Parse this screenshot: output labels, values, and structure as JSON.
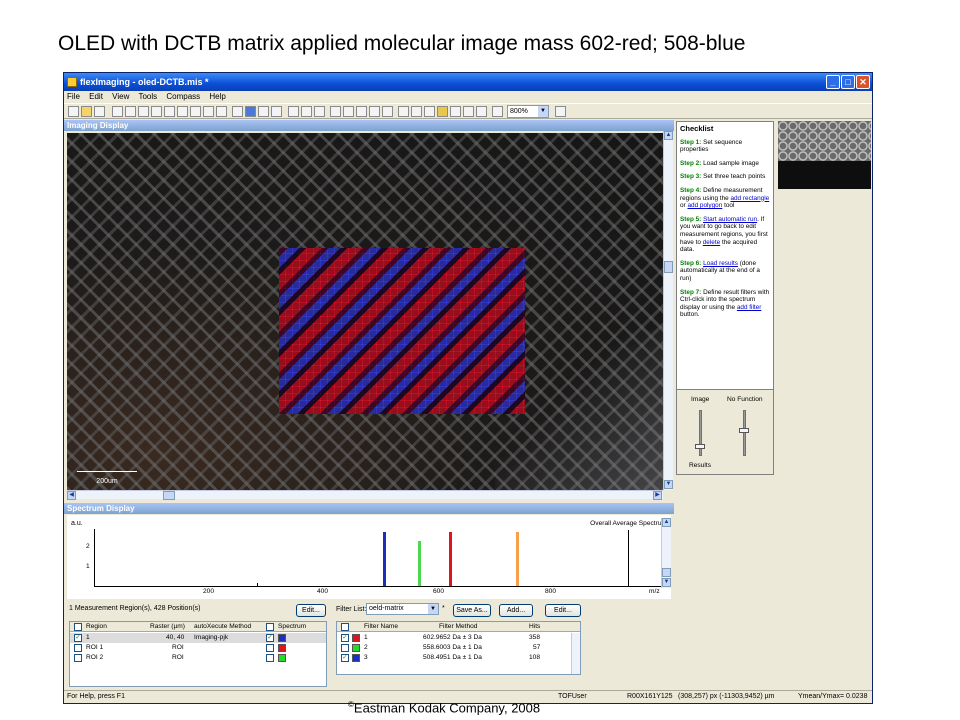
{
  "slide": {
    "title": "OLED with DCTB matrix applied  molecular image mass 602-red; 508-blue",
    "copyright_symbol": "©",
    "copyright_text": "Eastman Kodak Company, 2008"
  },
  "window": {
    "title": "flexImaging - oled-DCTB.mis *",
    "min_glyph": "_",
    "max_glyph": "□",
    "close_glyph": "✕"
  },
  "menu": [
    "File",
    "Edit",
    "View",
    "Tools",
    "Compass",
    "Help"
  ],
  "toolbar": {
    "zoom": "800%"
  },
  "imaging": {
    "header": "Imaging Display",
    "scale_label": "200um"
  },
  "checklist": {
    "title": "Checklist",
    "steps": [
      {
        "label": "Step 1:",
        "text": "Set sequence properties"
      },
      {
        "label": "Step 2:",
        "text": "Load sample image"
      },
      {
        "label": "Step 3:",
        "text": "Set three teach points"
      },
      {
        "label": "Step 4:",
        "pre": "Define measurement regions using the ",
        "link1": "add rectangle",
        "mid": " or ",
        "link2": "add polygon",
        "post": " tool"
      },
      {
        "label": "Step 5:",
        "link1": "Start automatic run",
        "post": ". If you want to go back to edit measurement regions, you first have to ",
        "link2": "delete",
        "post2": " the acquired data."
      },
      {
        "label": "Step 6:",
        "link1": "Load results",
        "post": " (done automatically at the end of a run)"
      },
      {
        "label": "Step 7:",
        "pre": "Define result filters with Ctrl-click into the spectrum display or using the ",
        "link1": "add filter",
        "post": " button."
      }
    ]
  },
  "sliders": {
    "left_label": "Image",
    "right_label": "No Function",
    "bottom_label": "Results"
  },
  "spectrum": {
    "header": "Spectrum Display",
    "yunit": "a.u.",
    "title": "Overall Average Spectrum",
    "xunit": "m/z",
    "yticks": [
      "2",
      "1"
    ],
    "xticks": [
      "200",
      "400",
      "600",
      "800"
    ]
  },
  "chart_data": {
    "type": "line",
    "title": "Overall Average Spectrum",
    "xlabel": "m/z",
    "ylabel": "a.u.",
    "xlim": [
      90,
      910
    ],
    "ylim": [
      0,
      2.6
    ],
    "peaks": [
      {
        "x": 508.5,
        "y": 2.4,
        "color": "#1a2fc0"
      },
      {
        "x": 558.6,
        "y": 2.0,
        "color": "#4fd84f"
      },
      {
        "x": 603.0,
        "y": 2.4,
        "color": "#e0141e"
      },
      {
        "x": 700.0,
        "y": 2.4,
        "color": "#f5a04a"
      },
      {
        "x": 325.0,
        "y": 0.15,
        "color": "#000000"
      },
      {
        "x": 860.0,
        "y": 2.5,
        "color": "#000000"
      }
    ]
  },
  "measurement": {
    "summary": "1 Measurement Region(s), 428 Position(s)",
    "edit_label": "Edit...",
    "columns": [
      "Region",
      "Raster (µm)",
      "autoXecute Method",
      "Spectrum"
    ],
    "rows": [
      {
        "region": "1",
        "raster": "40, 40",
        "method": "Imaging-pjk",
        "checked": "✓",
        "color": "#1a2fc0",
        "spec_checked": "✓"
      },
      {
        "region": "ROI 1",
        "raster": "ROI",
        "method": "",
        "checked": "",
        "color": "#e0141e",
        "spec_checked": ""
      },
      {
        "region": "ROI 2",
        "raster": "ROI",
        "method": "",
        "checked": "",
        "color": "#2ad82a",
        "spec_checked": ""
      }
    ]
  },
  "filters": {
    "label": "Filter List:",
    "selected": "oeld-matrix",
    "asterisk": "*",
    "save_label": "Save As...",
    "add_label": "Add...",
    "edit_label": "Edit...",
    "columns": [
      "Filter Name",
      "Filter Method",
      "Hits"
    ],
    "rows": [
      {
        "name": "1",
        "method": "602.9652 Da ± 3 Da",
        "hits": "358",
        "checked": "✓",
        "color": "#e0141e"
      },
      {
        "name": "2",
        "method": "558.6003 Da ± 1 Da",
        "hits": "57",
        "checked": "",
        "color": "#2ad82a"
      },
      {
        "name": "3",
        "method": "508.4951 Da ± 1 Da",
        "hits": "108",
        "checked": "✓",
        "color": "#1a2fc0"
      }
    ]
  },
  "status": {
    "help": "For Help, press F1",
    "user": "TOFUser",
    "raster": "R00X161Y125",
    "position": "(308,257) px  (-11303,9452) µm",
    "ymean": "Ymean/Ymax= 0.0238"
  },
  "colors": {
    "titlebar": "#0a4fd6",
    "red": "#e0141e",
    "blue": "#1a2fc0",
    "green": "#2ad82a"
  }
}
